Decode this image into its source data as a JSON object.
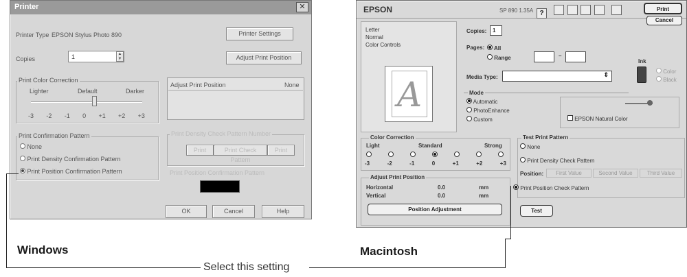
{
  "labels": {
    "windows": "Windows",
    "macintosh": "Macintosh",
    "callout": "Select this setting"
  },
  "windows_dialog": {
    "title": "Printer",
    "printer_type_label": "Printer Type",
    "printer_type_value": "EPSON Stylus Photo 890",
    "printer_settings_button": "Printer Settings",
    "copies_label": "Copies",
    "copies_value": "1",
    "adjust_print_position_button": "Adjust Print Position",
    "color_correction": {
      "title": "Print Color Correction",
      "lighter": "Lighter",
      "default": "Default",
      "darker": "Darker",
      "scale": [
        "-3",
        "-2",
        "-1",
        "0",
        "+1",
        "+2",
        "+3"
      ]
    },
    "adjust_panel": {
      "label": "Adjust Print Position",
      "value": "None"
    },
    "confirmation": {
      "title": "Print Confirmation Pattern",
      "options": [
        "None",
        "Print Density Confirmation Pattern",
        "Print Position Confirmation Pattern"
      ],
      "selected": 2
    },
    "density_panel_label": "Print Density Check Pattern Number",
    "density_buttons": [
      "Print",
      "Print Check Pattern",
      "Print"
    ],
    "print_position_hint": "Print Position Confirmation Pattern",
    "buttons": {
      "ok": "OK",
      "cancel": "Cancel",
      "help": "Help"
    }
  },
  "mac_dialog": {
    "brand": "EPSON",
    "version": "SP 890 1.35A",
    "buttons": {
      "print": "Print",
      "cancel": "Cancel"
    },
    "summary": [
      "Letter",
      "Normal",
      "Color Controls"
    ],
    "preview_glyph": "A",
    "copies_label": "Copies:",
    "copies_value": "1",
    "pages_label": "Pages:",
    "pages_all": "All",
    "pages_range": "Range",
    "range_sep": "–",
    "media_type_label": "Media Type:",
    "ink_label": "Ink",
    "ink_color": "Color",
    "ink_black": "Black",
    "mode_title": "Mode",
    "modes": [
      "Automatic",
      "PhotoEnhance",
      "Custom"
    ],
    "natural_color": "EPSON Natural Color",
    "color_correction": {
      "title": "Color Correction",
      "light": "Light",
      "standard": "Standard",
      "strong": "Strong",
      "scale": [
        "-3",
        "-2",
        "-1",
        "0",
        "+1",
        "+2",
        "+3"
      ],
      "selected": 3
    },
    "adjust_print_position": {
      "title": "Adjust Print Position",
      "horizontal_label": "Horizontal",
      "horizontal_value": "0.0",
      "vertical_label": "Vertical",
      "vertical_value": "0.0",
      "unit": "mm",
      "button": "Position Adjustment"
    },
    "test_print_pattern": {
      "title": "Test Print Pattern",
      "options": [
        "None",
        "Print Density Check Pattern",
        "Print Position Check Pattern"
      ],
      "selected": 2,
      "position_label": "Position:",
      "position_buttons": [
        "First Value",
        "Second Value",
        "Third Value"
      ]
    },
    "test_button": "Test"
  }
}
